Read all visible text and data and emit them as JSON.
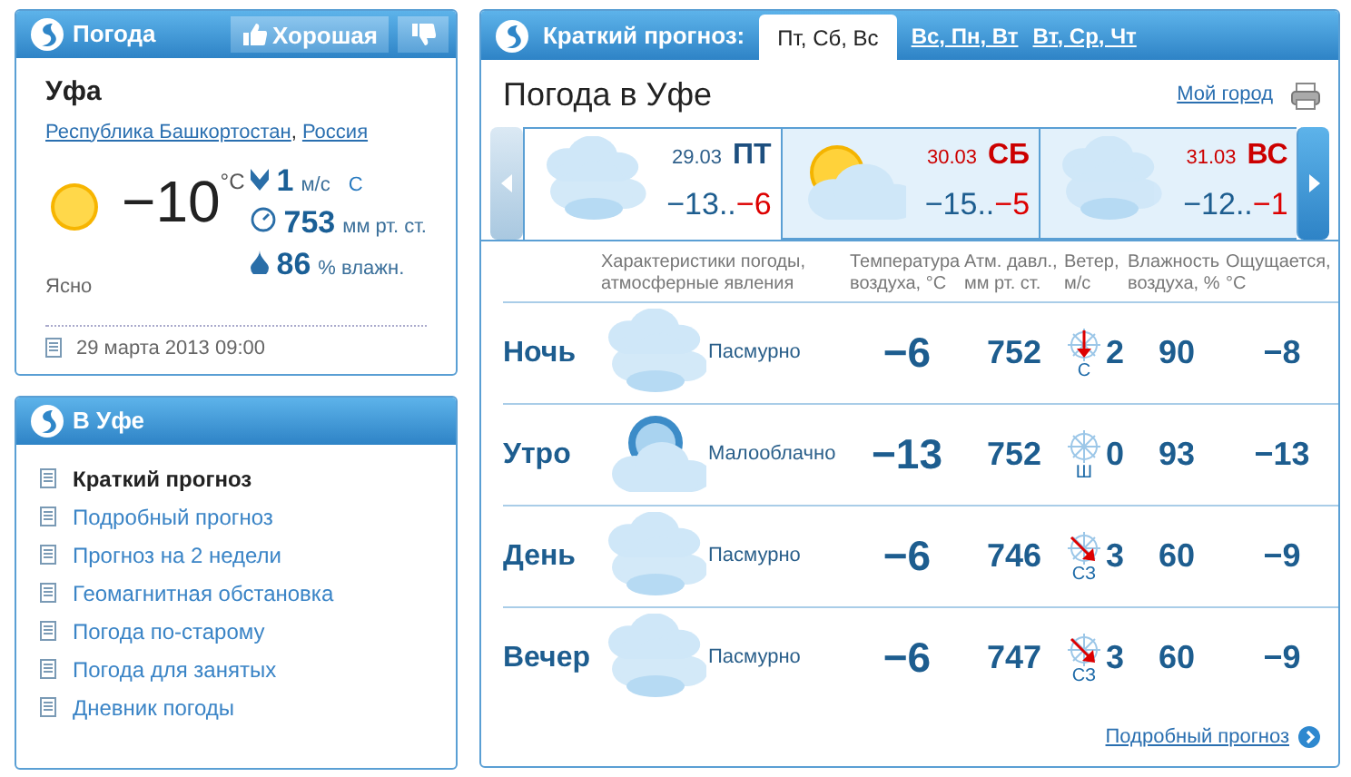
{
  "current": {
    "title": "Погода",
    "rating_button": "Хорошая",
    "city": "Уфа",
    "region_links": [
      "Республика Башкортостан",
      "Россия"
    ],
    "region_separator": ",",
    "kind": "sunny",
    "temperature": "−10",
    "unit": "°C",
    "wind_speed": "1",
    "wind_unit": "м/с",
    "wind_direction": "С",
    "pressure": "753",
    "pressure_unit": "мм рт. ст.",
    "humidity": "86",
    "humidity_unit": "% влажн.",
    "condition": "Ясно",
    "updated": "29 марта 2013 09:00"
  },
  "menu": {
    "title": "В Уфе",
    "items": [
      {
        "label": "Краткий прогноз",
        "selected": true
      },
      {
        "label": "Подробный прогноз",
        "selected": false
      },
      {
        "label": "Прогноз на 2 недели",
        "selected": false
      },
      {
        "label": "Геомагнитная обстановка",
        "selected": false
      },
      {
        "label": "Погода по-старому",
        "selected": false
      },
      {
        "label": "Погода для занятых",
        "selected": false
      },
      {
        "label": "Дневник погоды",
        "selected": false
      }
    ]
  },
  "forecast": {
    "label": "Краткий прогноз:",
    "tabs": [
      {
        "label": "Пт, Сб, Вс",
        "selected": true
      },
      {
        "label": "Вс, Пн, Вт",
        "selected": false
      },
      {
        "label": "Вт, Ср, Чт",
        "selected": false
      }
    ],
    "title": "Погода в Уфе",
    "my_city_link": "Мой город",
    "days": [
      {
        "date": "29.03",
        "day": "ПТ",
        "min": "−13",
        "separator": "..",
        "max": "−6",
        "weekend": false,
        "selected": true,
        "kind": "overcast"
      },
      {
        "date": "30.03",
        "day": "СБ",
        "min": "−15",
        "separator": "..",
        "max": "−5",
        "weekend": true,
        "selected": false,
        "kind": "partly_sunny"
      },
      {
        "date": "31.03",
        "day": "ВС",
        "min": "−12",
        "separator": "..",
        "max": "−1",
        "weekend": true,
        "selected": false,
        "kind": "overcast"
      }
    ],
    "columns": [
      "Характеристики погоды, атмосферные явления",
      "Температура воздуха, °С",
      "Атм. давл., мм рт. ст.",
      "Ветер, м/с",
      "Влажность воздуха, %",
      "Ощущается, °С"
    ],
    "rows": [
      {
        "period": "Ночь",
        "kind": "overcast",
        "condition": "Пасмурно",
        "temperature": "−6",
        "pressure": "752",
        "wind": {
          "kind": "down",
          "direction": "С",
          "speed": "2"
        },
        "humidity": "90",
        "feels_like": "−8"
      },
      {
        "period": "Утро",
        "kind": "partly_cloudy",
        "condition": "Малооблачно",
        "temperature": "−13",
        "pressure": "752",
        "wind": {
          "kind": "calm",
          "direction": "Ш",
          "speed": "0"
        },
        "humidity": "93",
        "feels_like": "−13"
      },
      {
        "period": "День",
        "kind": "overcast",
        "condition": "Пасмурно",
        "temperature": "−6",
        "pressure": "746",
        "wind": {
          "kind": "diagonal",
          "direction": "СЗ",
          "speed": "3"
        },
        "humidity": "60",
        "feels_like": "−9"
      },
      {
        "period": "Вечер",
        "kind": "overcast",
        "condition": "Пасмурно",
        "temperature": "−6",
        "pressure": "747",
        "wind": {
          "kind": "diagonal",
          "direction": "СЗ",
          "speed": "3"
        },
        "humidity": "60",
        "feels_like": "−9"
      }
    ],
    "footer_link": "Подробный прогноз"
  }
}
